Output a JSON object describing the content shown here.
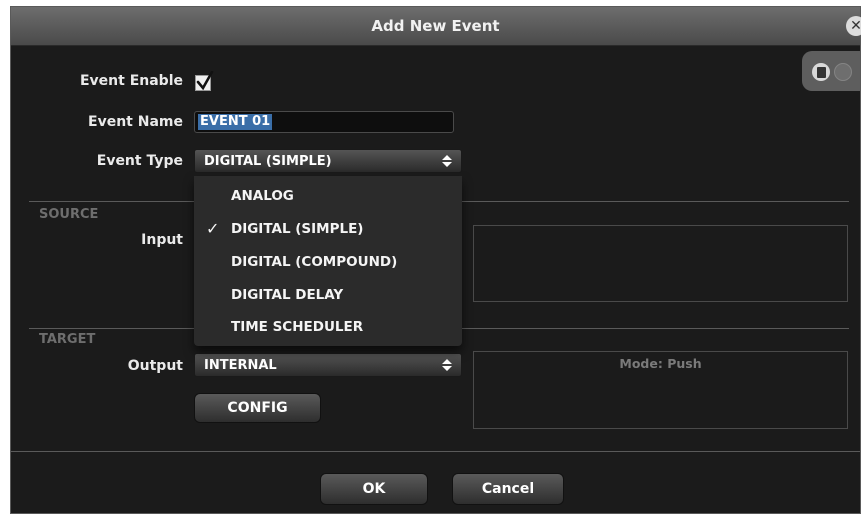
{
  "dialog": {
    "title": "Add New Event",
    "close_icon": "close-icon"
  },
  "toolbar": {
    "copy_icon": "copy-icon",
    "paste_icon": "paste-icon"
  },
  "form": {
    "enable_label": "Event Enable",
    "enable_checked": true,
    "name_label": "Event Name",
    "name_value": "EVENT 01",
    "type_label": "Event Type",
    "type_value": "DIGITAL (SIMPLE)"
  },
  "type_options": {
    "items": [
      "ANALOG",
      "DIGITAL (SIMPLE)",
      "DIGITAL (COMPOUND)",
      "DIGITAL DELAY",
      "TIME SCHEDULER"
    ],
    "selected": "DIGITAL (SIMPLE)",
    "check_mark": "✓"
  },
  "source": {
    "section_label": "SOURCE",
    "input_label": "Input"
  },
  "target": {
    "section_label": "TARGET",
    "output_label": "Output",
    "output_value": "INTERNAL",
    "config_label": "CONFIG",
    "mode_text": "Mode: Push"
  },
  "footer": {
    "ok_label": "OK",
    "cancel_label": "Cancel"
  },
  "colors": {
    "dialog_bg": "#1b1b1b",
    "titlebar": "#5a5a5a",
    "selection": "#3a6ea8"
  }
}
